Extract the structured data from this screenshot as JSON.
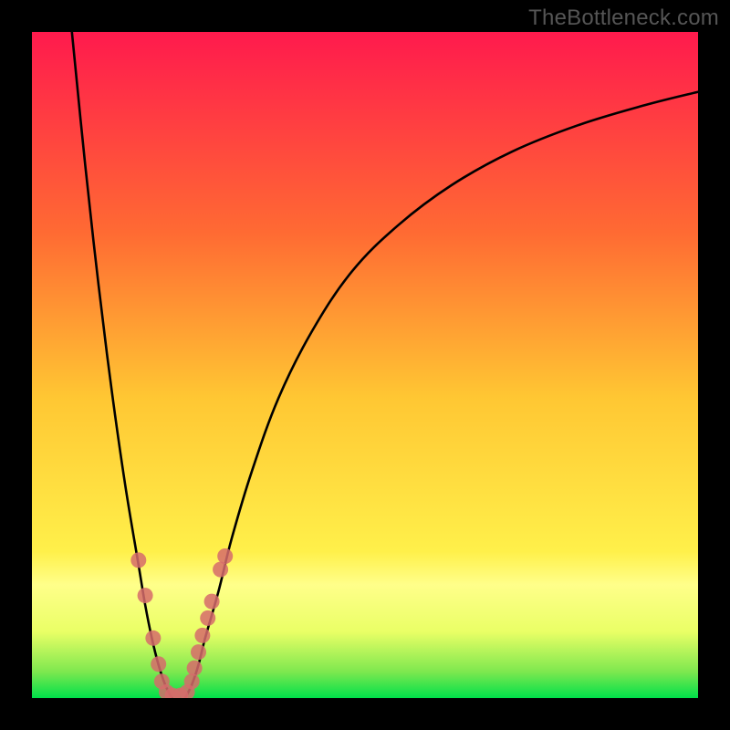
{
  "watermark": "TheBottleneck.com",
  "colors": {
    "gradient_top": "#ff1a4d",
    "gradient_mid1": "#ff7a33",
    "gradient_mid2": "#ffd633",
    "gradient_yellowband": "#ffff8a",
    "gradient_bottom": "#00e04a",
    "curve": "#000000",
    "marker": "#d66b6b",
    "frame": "#000000"
  },
  "chart_data": {
    "type": "line",
    "title": "",
    "xlabel": "",
    "ylabel": "",
    "xlim": [
      0,
      100
    ],
    "ylim": [
      0,
      100
    ],
    "series": [
      {
        "name": "left-branch",
        "x": [
          6,
          8,
          10,
          12,
          14,
          16,
          17,
          18,
          19,
          20,
          21
        ],
        "y": [
          100,
          80,
          62,
          46,
          32,
          20,
          14,
          9,
          5,
          2,
          0
        ]
      },
      {
        "name": "right-branch",
        "x": [
          23,
          24,
          25,
          26,
          28,
          30,
          33,
          37,
          42,
          48,
          55,
          63,
          72,
          82,
          92,
          100
        ],
        "y": [
          0,
          2,
          5,
          9,
          16,
          24,
          34,
          45,
          55,
          64,
          71,
          77,
          82,
          86,
          89,
          91
        ]
      }
    ],
    "markers": [
      {
        "x": 16.0,
        "y": 20.7
      },
      {
        "x": 17.0,
        "y": 15.4
      },
      {
        "x": 18.2,
        "y": 9.0
      },
      {
        "x": 19.0,
        "y": 5.1
      },
      {
        "x": 19.5,
        "y": 2.5
      },
      {
        "x": 20.2,
        "y": 0.9
      },
      {
        "x": 21.1,
        "y": 0.4
      },
      {
        "x": 22.3,
        "y": 0.4
      },
      {
        "x": 23.3,
        "y": 0.9
      },
      {
        "x": 24.0,
        "y": 2.5
      },
      {
        "x": 24.4,
        "y": 4.5
      },
      {
        "x": 25.0,
        "y": 6.9
      },
      {
        "x": 25.6,
        "y": 9.4
      },
      {
        "x": 26.4,
        "y": 12.0
      },
      {
        "x": 27.0,
        "y": 14.5
      },
      {
        "x": 28.3,
        "y": 19.3
      },
      {
        "x": 29.0,
        "y": 21.3
      }
    ],
    "gradient_stops": [
      {
        "pos": 0.0,
        "color": "#ff1a4d"
      },
      {
        "pos": 0.3,
        "color": "#ff6a33"
      },
      {
        "pos": 0.55,
        "color": "#ffc733"
      },
      {
        "pos": 0.78,
        "color": "#fff04a"
      },
      {
        "pos": 0.83,
        "color": "#ffff8a"
      },
      {
        "pos": 0.9,
        "color": "#eaff66"
      },
      {
        "pos": 0.96,
        "color": "#7fe84f"
      },
      {
        "pos": 1.0,
        "color": "#00e04a"
      }
    ]
  }
}
